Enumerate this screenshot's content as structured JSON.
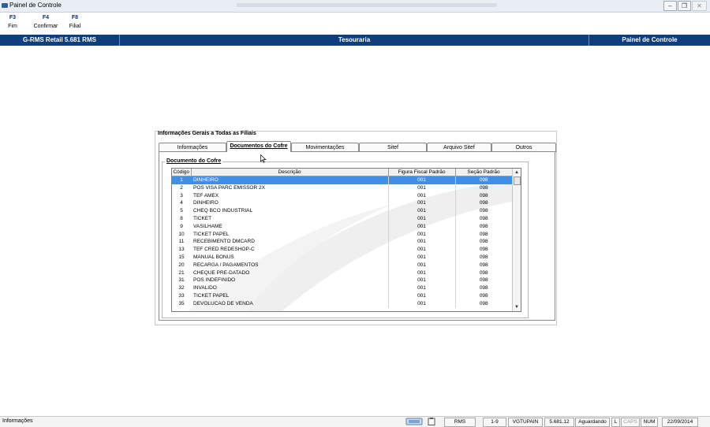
{
  "window": {
    "title": "Painel de Controle"
  },
  "fkeys": [
    {
      "key": "F3",
      "label": "Fim"
    },
    {
      "key": "F4",
      "label": "Confirmar"
    },
    {
      "key": "F8",
      "label": "Filial"
    }
  ],
  "header": {
    "left": "G-RMS Retail 5.681 RMS",
    "center": "Tesouraria",
    "right": "Painel de Controle"
  },
  "panel": {
    "title": "Informações Gerais a Todas as Filiais",
    "tabs": [
      "Informações",
      "Documentos do Cofre",
      "Movimentações",
      "Sitef",
      "Arquivo Sitef",
      "Outros"
    ],
    "active_tab": "Documentos do Cofre",
    "group_title": "Documento do Cofre",
    "columns": [
      "Código",
      "Descrição",
      "Figura Fiscal Padrão",
      "Seção Padrão"
    ],
    "rows": [
      {
        "codigo": "1",
        "descricao": "DINHEIRO",
        "figura": "001",
        "secao": "098"
      },
      {
        "codigo": "2",
        "descricao": "POS VISA PARC EMISSOR  2X",
        "figura": "001",
        "secao": "098"
      },
      {
        "codigo": "3",
        "descricao": "TEF AMEX",
        "figura": "001",
        "secao": "098"
      },
      {
        "codigo": "4",
        "descricao": "DINHEIRO",
        "figura": "001",
        "secao": "098"
      },
      {
        "codigo": "5",
        "descricao": "CHEQ BCO INDUSTRIAL",
        "figura": "001",
        "secao": "098"
      },
      {
        "codigo": "8",
        "descricao": "TICKET",
        "figura": "001",
        "secao": "098"
      },
      {
        "codigo": "9",
        "descricao": "VASILHAME",
        "figura": "001",
        "secao": "098"
      },
      {
        "codigo": "10",
        "descricao": "TICKET PAPEL",
        "figura": "001",
        "secao": "098"
      },
      {
        "codigo": "11",
        "descricao": "RECEBIMENTO DMCARD",
        "figura": "001",
        "secao": "098"
      },
      {
        "codigo": "13",
        "descricao": "TEF CRED REDESHOP-C",
        "figura": "001",
        "secao": "098"
      },
      {
        "codigo": "15",
        "descricao": "MANUAL BONUS",
        "figura": "001",
        "secao": "098"
      },
      {
        "codigo": "20",
        "descricao": "RECARGA / PAGAMENTOS",
        "figura": "001",
        "secao": "098"
      },
      {
        "codigo": "21",
        "descricao": "CHEQUE PRE-DATADO",
        "figura": "001",
        "secao": "098"
      },
      {
        "codigo": "31",
        "descricao": "POS INDEFINIDO",
        "figura": "001",
        "secao": "098"
      },
      {
        "codigo": "32",
        "descricao": "INVALIDO",
        "figura": "001",
        "secao": "098"
      },
      {
        "codigo": "33",
        "descricao": "TICKET PAPEL",
        "figura": "001",
        "secao": "098"
      },
      {
        "codigo": "35",
        "descricao": "DEVOLUCAO DE VENDA",
        "figura": "001",
        "secao": "098"
      }
    ],
    "selected_row": 0
  },
  "statusbar": {
    "left": "Informações",
    "cells": [
      "RMS",
      "1-9",
      "VGTUPAIN",
      "5.681.12",
      "Aguardando",
      "L",
      "CAPS",
      "NUM",
      "22/09/2014"
    ]
  },
  "colors": {
    "header_bg": "#0f3e7d",
    "selection": "#3f8fe6",
    "fkey": "#0b2b7a"
  }
}
